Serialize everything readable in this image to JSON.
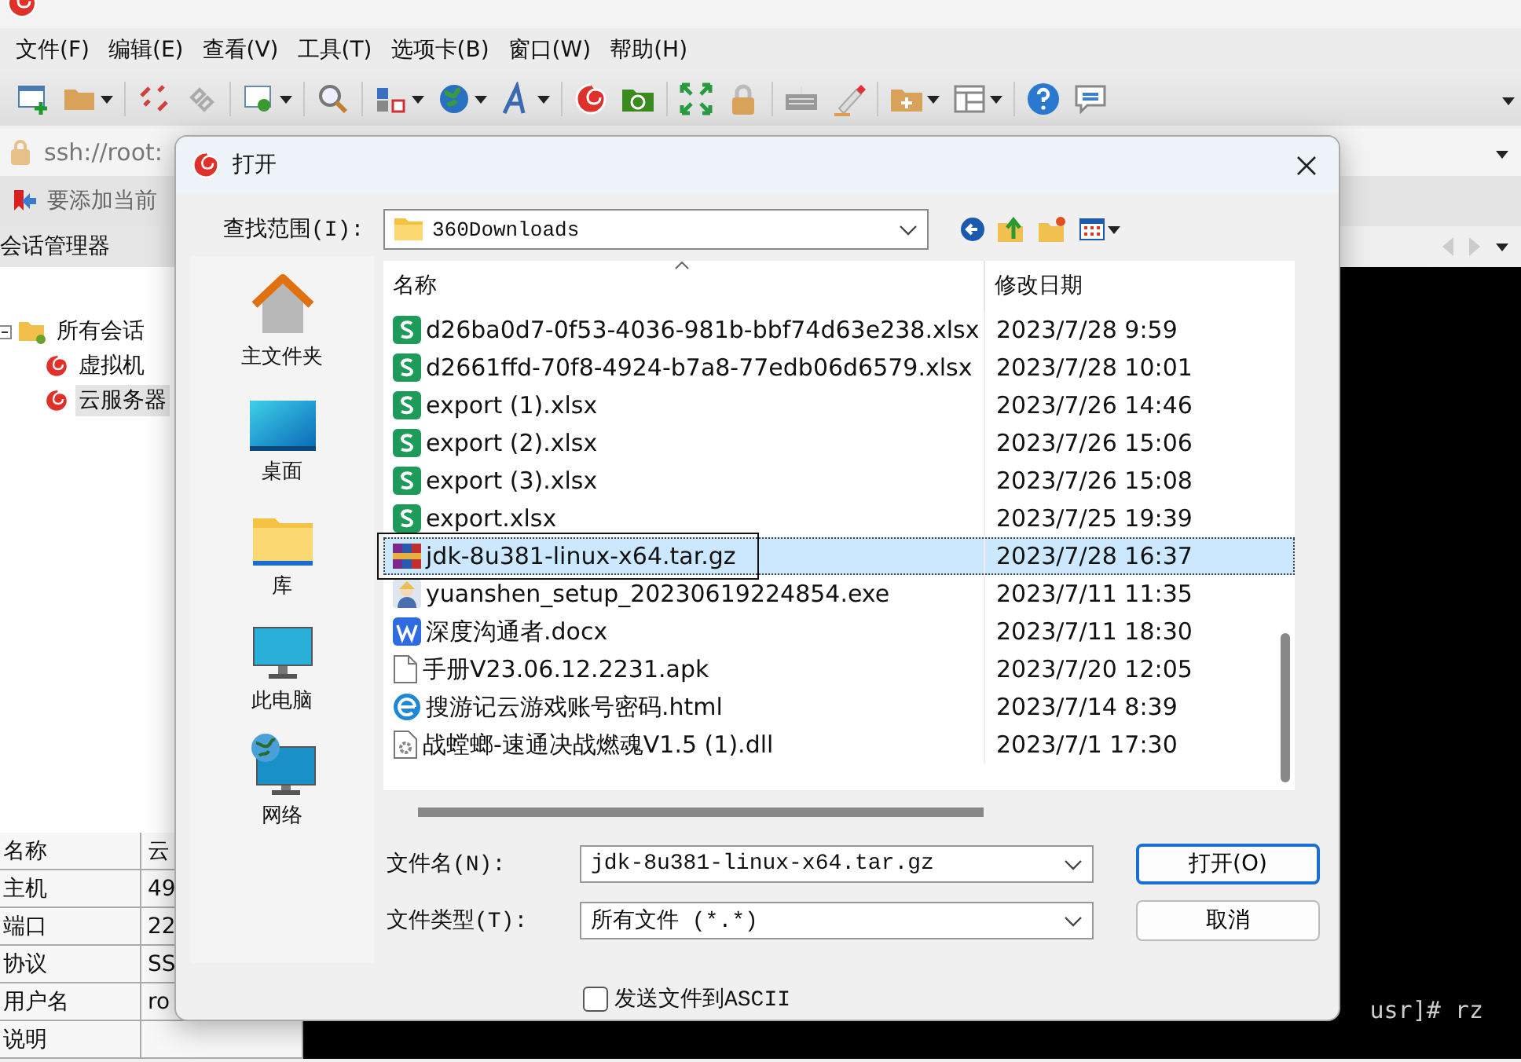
{
  "menu": [
    "文件(F)",
    "编辑(E)",
    "查看(V)",
    "工具(T)",
    "选项卡(B)",
    "窗口(W)",
    "帮助(H)"
  ],
  "address_bar": {
    "text": "ssh://root:"
  },
  "bookmark_bar": {
    "text": "要添加当前"
  },
  "session_manager": {
    "title": "会话管理器",
    "tree": [
      {
        "label": "所有会话",
        "expanded": true,
        "selected": false,
        "children": [
          {
            "label": "虚拟机",
            "selected": false
          },
          {
            "label": "云服务器",
            "selected": true
          }
        ]
      }
    ]
  },
  "properties": [
    {
      "name": "名称",
      "value": "云"
    },
    {
      "name": "主机",
      "value": "49"
    },
    {
      "name": "端口",
      "value": "22"
    },
    {
      "name": "协议",
      "value": "SS"
    },
    {
      "name": "用户名",
      "value": "ro"
    },
    {
      "name": "说明"
    }
  ],
  "terminal": {
    "lines": [
      "usr]# rz"
    ]
  },
  "dialog": {
    "title": "打开",
    "look_in_label": "查找范围(I):",
    "look_in": "360Downloads",
    "places": [
      {
        "label": "主文件夹",
        "kind": "home"
      },
      {
        "label": "桌面",
        "kind": "desktop"
      },
      {
        "label": "库",
        "kind": "library"
      },
      {
        "label": "此电脑",
        "kind": "computer"
      },
      {
        "label": "网络",
        "kind": "network"
      }
    ],
    "columns": [
      "名称",
      "修改日期"
    ],
    "files": [
      {
        "name": "d26ba0d7-0f53-4036-981b-bbf74d63e238.xlsx",
        "date": "2023/7/28 9:59",
        "kind": "sheet",
        "selected": false
      },
      {
        "name": "d2661ffd-70f8-4924-b7a8-77edb06d6579.xlsx",
        "date": "2023/7/28 10:01",
        "kind": "sheet",
        "selected": false
      },
      {
        "name": "export (1).xlsx",
        "date": "2023/7/26 14:46",
        "kind": "sheet",
        "selected": false
      },
      {
        "name": "export (2).xlsx",
        "date": "2023/7/26 15:06",
        "kind": "sheet",
        "selected": false
      },
      {
        "name": "export (3).xlsx",
        "date": "2023/7/26 15:08",
        "kind": "sheet",
        "selected": false
      },
      {
        "name": "export.xlsx",
        "date": "2023/7/25 19:39",
        "kind": "sheet",
        "selected": false
      },
      {
        "name": "jdk-8u381-linux-x64.tar.gz",
        "date": "2023/7/28 16:37",
        "kind": "archive",
        "selected": true
      },
      {
        "name": "yuanshen_setup_20230619224854.exe",
        "date": "2023/7/11 11:35",
        "kind": "exe",
        "selected": false
      },
      {
        "name": "深度沟通者.docx",
        "date": "2023/7/11 18:30",
        "kind": "doc",
        "selected": false
      },
      {
        "name": "手册V23.06.12.2231.apk",
        "date": "2023/7/20 12:05",
        "kind": "blank",
        "selected": false
      },
      {
        "name": "搜游记云游戏账号密码.html",
        "date": "2023/7/14 8:39",
        "kind": "web",
        "selected": false
      },
      {
        "name": "战螳螂-速通决战燃魂V1.5 (1).dll",
        "date": "2023/7/1 17:30",
        "kind": "dll",
        "selected": false
      }
    ],
    "file_name_label": "文件名(N):",
    "file_name": "jdk-8u381-linux-x64.tar.gz",
    "file_type_label": "文件类型(T):",
    "file_type": "所有文件 (*.*)",
    "buttons": [
      {
        "label": "打开(O)",
        "default": true
      },
      {
        "label": "取消",
        "default": false
      }
    ],
    "ascii_checkbox": {
      "label": "发送文件到ASCII",
      "checked": false
    }
  }
}
